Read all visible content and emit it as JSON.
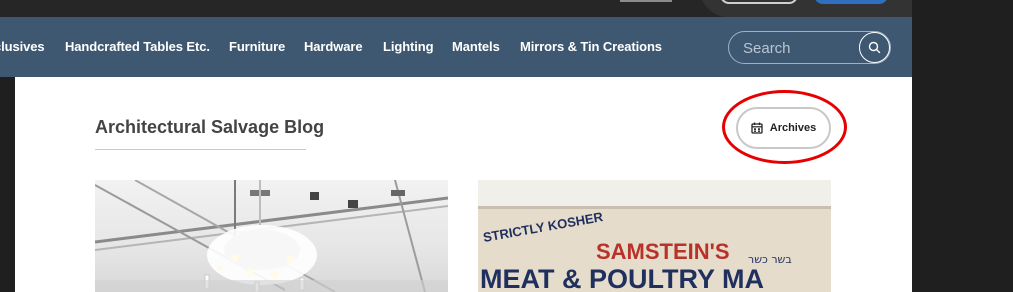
{
  "nav": {
    "items": [
      {
        "label": "clusives"
      },
      {
        "label": "Handcrafted Tables Etc."
      },
      {
        "label": "Furniture"
      },
      {
        "label": "Hardware"
      },
      {
        "label": "Lighting"
      },
      {
        "label": "Mantels"
      },
      {
        "label": "Mirrors & Tin Creations"
      }
    ],
    "search": {
      "placeholder": "Search",
      "icon": "search-icon"
    }
  },
  "blog": {
    "title": "Architectural Salvage Blog",
    "archives_label": "Archives",
    "archives_icon": "calendar-icon"
  },
  "sign": {
    "line1": "STRICTLY KOSHER",
    "line2": "SAMSTEIN'S",
    "line3": "MEAT & POULTRY MA",
    "hebrew": "בשר כשר"
  },
  "colors": {
    "nav_bg": "#3f5872",
    "highlight": "#e60000",
    "sign_red": "#b8322a",
    "sign_navy": "#1f2f5e"
  }
}
